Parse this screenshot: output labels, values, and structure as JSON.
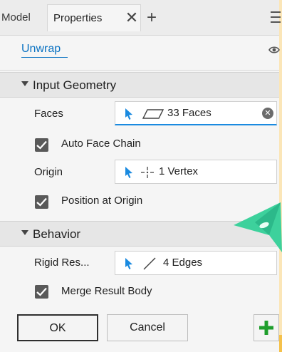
{
  "tabs": {
    "model_label": "Model",
    "properties_label": "Properties",
    "close_glyph": "✕",
    "add_glyph": "+"
  },
  "header": {
    "title": "Unwrap"
  },
  "sections": {
    "input_geometry": {
      "label": "Input Geometry",
      "faces_label": "Faces",
      "faces_value": "33 Faces",
      "auto_face_chain_label": "Auto Face Chain",
      "auto_face_chain_checked": true,
      "origin_label": "Origin",
      "origin_value": "1 Vertex",
      "position_at_origin_label": "Position at Origin",
      "position_at_origin_checked": true
    },
    "behavior": {
      "label": "Behavior",
      "rigid_label": "Rigid Res...",
      "rigid_value": "4 Edges",
      "merge_label": "Merge Result Body",
      "merge_checked": true
    }
  },
  "buttons": {
    "ok_label": "OK",
    "cancel_label": "Cancel",
    "apply_glyph": "+"
  },
  "icons": {
    "cursor": "select-arrow-icon",
    "face": "face-parallelogram-icon",
    "vertex": "vertex-crosshair-icon",
    "edge": "edge-line-icon",
    "clear": "clear-x-icon",
    "visibility": "eye-icon",
    "menu": "hamburger-menu-icon"
  },
  "colors": {
    "accent": "#0a72c2",
    "cursor_blue": "#1a8ae0",
    "checkbox": "#595959",
    "apply_green": "#1e9e2c",
    "panel_bg": "#f5f5f5",
    "section_bg": "#e6e6e6"
  }
}
